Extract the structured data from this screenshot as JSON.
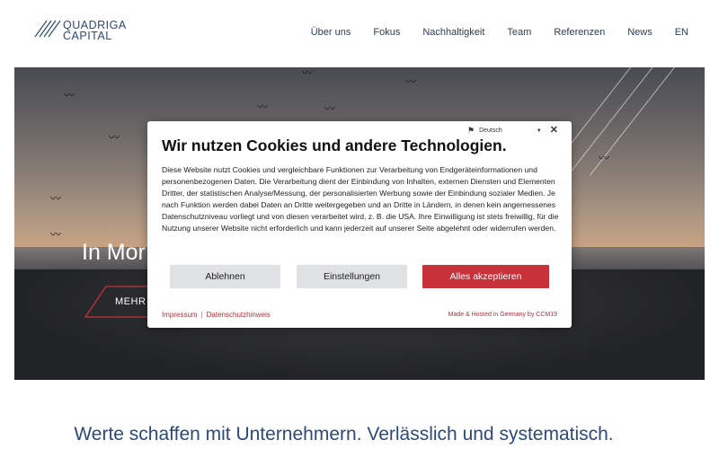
{
  "header": {
    "logo": {
      "line1": "QUADRIGA",
      "line2": "CAPITAL"
    },
    "nav": [
      "Über uns",
      "Fokus",
      "Nachhaltigkeit",
      "Team",
      "Referenzen",
      "News",
      "EN"
    ]
  },
  "hero": {
    "title": "In Mor",
    "button_label": "MEHR E"
  },
  "tagline": "Werte schaffen mit Unternehmern. Verlässlich und systematisch.",
  "cookie": {
    "language": "Deutsch",
    "title": "Wir nutzen Cookies und andere Technologien.",
    "body": "Diese Website nutzt Cookies und vergleichbare Funktionen zur Verarbeitung von Endgeräteinformationen und personenbezogenen Daten. Die Verarbeitung dient der Einbindung von Inhalten, externen Diensten und Elementen Dritter, der statistischen Analyse/Messung, der personalisierten Werbung sowie der Einbindung sozialer Medien. Je nach Funktion werden dabei Daten an Dritte weitergegeben und an Dritte in Ländern, in denen kein angemessenes Datenschutzniveau vorliegt und von diesen verarbeitet wird, z. B. die USA. Ihre Einwilligung ist stets freiwillig, für die Nutzung unserer Website nicht erforderlich und kann jederzeit auf unserer Seite abgelehnt oder widerrufen werden.",
    "decline_label": "Ablehnen",
    "settings_label": "Einstellungen",
    "accept_label": "Alles akzeptieren",
    "imprint_link": "Impressum",
    "separator": "|",
    "privacy_link": "Datenschutzhinweis",
    "hosted": "Made & Hosted in Germany by CCM19"
  },
  "colors": {
    "brand_blue": "#2b4a7a",
    "accept_red": "#c8313a",
    "button_grey": "#dfe1e3"
  }
}
